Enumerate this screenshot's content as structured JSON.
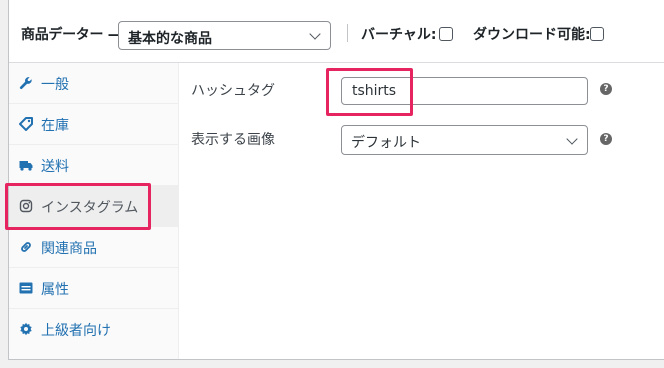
{
  "header": {
    "product_data_label": "商品データー —",
    "product_type_value": "基本的な商品",
    "virtual_label": "バーチャル:",
    "virtual_checked": false,
    "downloadable_label": "ダウンロード可能:",
    "downloadable_checked": false
  },
  "sidebar": {
    "items": [
      {
        "label": "一般",
        "icon": "wrench-icon"
      },
      {
        "label": "在庫",
        "icon": "tag-icon"
      },
      {
        "label": "送料",
        "icon": "truck-icon"
      },
      {
        "label": "インスタグラム",
        "icon": "instagram-icon",
        "active": true
      },
      {
        "label": "関連商品",
        "icon": "link-icon"
      },
      {
        "label": "属性",
        "icon": "list-icon"
      },
      {
        "label": "上級者向け",
        "icon": "gear-icon"
      }
    ]
  },
  "main": {
    "hashtag_label": "ハッシュタグ",
    "hashtag_value": "tshirts",
    "image_label": "表示する画像",
    "image_value": "デフォルト",
    "help_glyph": "?"
  },
  "colors": {
    "highlight": "#e6245f",
    "link": "#2271b1"
  }
}
